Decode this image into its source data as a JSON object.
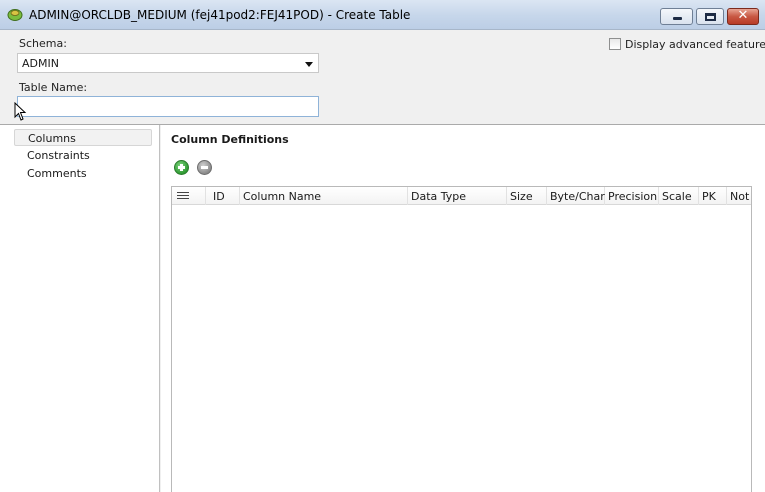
{
  "window": {
    "title": "ADMIN@ORCLDB_MEDIUM (fej41pod2:FEJ41POD) - Create Table",
    "icons": {
      "app": "sql-developer-icon",
      "minimize": "minimize-icon",
      "maximize": "maximize-icon",
      "close": "close-icon"
    },
    "close_glyph": "✕"
  },
  "form": {
    "schema_label": "Schema:",
    "schema_value": "ADMIN",
    "table_name_label": "Table Name:",
    "table_name_value": "",
    "advanced_label": "Display advanced features",
    "advanced_checked": false
  },
  "nav": {
    "items": [
      {
        "label": "Columns",
        "selected": true
      },
      {
        "label": "Constraints",
        "selected": false
      },
      {
        "label": "Comments",
        "selected": false
      }
    ]
  },
  "main": {
    "section_title": "Column Definitions",
    "toolbar": {
      "add_icon": "add-icon",
      "remove_icon": "remove-icon"
    },
    "grid": {
      "columns": [
        "ID",
        "Column Name",
        "Data Type",
        "Size",
        "Byte/Char",
        "Precision",
        "Scale",
        "PK",
        "Not"
      ],
      "rows": []
    }
  },
  "colors": {
    "titlebar": "#c6d6ea",
    "background": "#f0f0f0",
    "close_button": "#c85843",
    "add_button": "#2f9a33"
  }
}
